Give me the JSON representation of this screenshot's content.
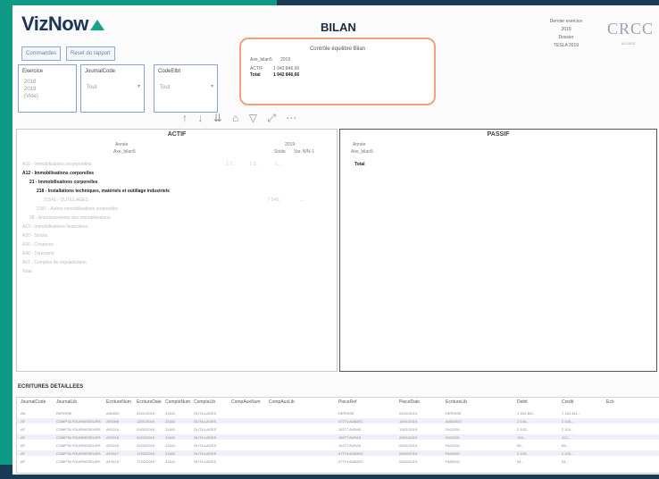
{
  "app": {
    "logo_text": "VizNow",
    "page_title": "BILAN"
  },
  "buttons": {
    "b1": "Commandes",
    "b2": "Reset du rapport"
  },
  "slicers": [
    {
      "title": "Exercice",
      "options": [
        "2018",
        "2019",
        "(Vide)"
      ]
    },
    {
      "title": "JournalCode",
      "value": "Tout"
    },
    {
      "title": "CodeEtbt",
      "value": "Tout"
    }
  ],
  "control": {
    "title": "Contrôle équilibre Bilan",
    "col1": "Axe_bilan5",
    "col2": "2019",
    "r1_label": "ACTIF",
    "r1_val": "1 942 846,66",
    "r2_label": "Total",
    "r2_val": "1 942 846,66"
  },
  "meta": {
    "l1": "Dernier exercice",
    "l2": "2019",
    "l3": "Dossier",
    "l4": "TESLA 2019"
  },
  "brand": {
    "name": "CRCC",
    "sub": "ALSACE"
  },
  "toolbar": {
    "up": "↑",
    "down": "↓",
    "split": "⇊",
    "home": "⌂",
    "filter": "▽",
    "expand": "⤢",
    "more": "⋯"
  },
  "actif": {
    "title": "ACTIF",
    "year_label": "Année",
    "axe_label": "Axe_bilan5",
    "year": "2019",
    "c1": "Solde",
    "c2": "Var. N/N-1",
    "rows": [
      {
        "label": "A10 - Immobilisations incorporelles",
        "bold": false,
        "indent": 0,
        "v": [
          "1 2..",
          "1 3..",
          "1..."
        ]
      },
      {
        "label": "A12 - Immobilisations corporelles",
        "bold": true,
        "indent": 0,
        "v": [
          "",
          "",
          "",
          ""
        ]
      },
      {
        "label": "21 - Immobilisations corporelles",
        "bold": true,
        "indent": 1,
        "v": [
          "",
          "",
          "",
          ""
        ]
      },
      {
        "label": "218 - Installations techniques, matériels et outillage industriels",
        "bold": true,
        "indent": 2,
        "v": [
          "",
          "",
          "",
          ""
        ]
      },
      {
        "label": "21541 - OUTILLAGES",
        "bold": false,
        "indent": 3,
        "v": [
          "",
          "",
          "7 548,-",
          "...."
        ]
      },
      {
        "label": "2181 - Autres immobilisations corporelles",
        "bold": false,
        "indent": 2,
        "v": [
          "",
          "",
          "",
          ""
        ]
      },
      {
        "label": "28 - Amortissements des immobilisations",
        "bold": false,
        "indent": 1,
        "v": [
          "",
          "",
          "",
          ""
        ]
      },
      {
        "label": "A13 - Immobilisations financières",
        "bold": false,
        "indent": 0,
        "v": [
          "",
          "",
          "",
          ""
        ]
      },
      {
        "label": "A20 - Stocks",
        "bold": false,
        "indent": 0,
        "v": [
          "",
          "",
          "",
          ""
        ]
      },
      {
        "label": "A30 - Créances",
        "bold": false,
        "indent": 0,
        "v": [
          "",
          "",
          "",
          ""
        ]
      },
      {
        "label": "A40 - Trésorerie",
        "bold": false,
        "indent": 0,
        "v": [
          "",
          "",
          "",
          ""
        ]
      },
      {
        "label": "A51 - Comptes de régularisation",
        "bold": false,
        "indent": 0,
        "v": [
          "",
          "",
          "",
          ""
        ]
      },
      {
        "label": "Total",
        "bold": false,
        "indent": 0,
        "v": [
          "",
          "",
          "",
          ""
        ]
      }
    ]
  },
  "passif": {
    "title": "PASSIF",
    "year_label": "Année",
    "axe_label": "Axe_bilan5",
    "total_label": "Total"
  },
  "ecritures": {
    "title": "ECRITURES DETAILLEES",
    "columns": [
      "JournalCode",
      "JournalLib",
      "EcritureNum",
      "EcritureDate",
      "CompteNum",
      "CompteLib",
      "CompAuxNum",
      "CompAuxLib",
      "PieceRef",
      "PieceDate",
      "EcritureLib",
      "Debit",
      "Credit",
      "Ech"
    ],
    "rows": [
      [
        "AN",
        "REPRISE",
        "AN0000",
        "01/01/2019",
        "21541",
        "OUTILLAGES",
        "",
        "",
        "REPRISE",
        "01/01/2019",
        "REPRISE",
        "1 154 361,-",
        "1 154 361,-"
      ],
      [
        "AF",
        "COMPTA FOURNISSEURS",
        "AF0006",
        "12/01/2019",
        "21541",
        "OUTILLAGES",
        "",
        "",
        "07774 AVADEC",
        "10/01/2019",
        "AVA00017",
        "2 148,-",
        "2 148,-"
      ],
      [
        "AF",
        "COMPTA FOURNISSEURS",
        "AF0214",
        "01/02/2019",
        "21541",
        "OUTILLAGES",
        "",
        "",
        "15277 AVRAS",
        "13/01/2019",
        "FA12001",
        "2 103,-",
        "2 103,-"
      ],
      [
        "AF",
        "COMPTA FOURNISSEURS",
        "AF0216",
        "01/02/2019",
        "21541",
        "OUTILLAGES",
        "",
        "",
        "15277 AVRAS",
        "20/01/2019",
        "FA12001",
        "122,-",
        "122,-"
      ],
      [
        "AF",
        "COMPTA FOURNISSEURS",
        "AF0216",
        "01/02/2019",
        "21541",
        "OUTILLAGES",
        "",
        "",
        "15277 AVRAS",
        "20/01/2019",
        "FA12001",
        "65,-",
        "65,-"
      ],
      [
        "AF",
        "COMPTA FOURNISSEURS",
        "AF0417",
        "17/02/2019",
        "21541",
        "OUTILLAGES",
        "",
        "",
        "07774 AVADEC",
        "09/02/2019",
        "FA00001",
        "2 105,-",
        "2 105,-"
      ],
      [
        "AF",
        "COMPTA FOURNISSEURS",
        "AF0419",
        "17/02/2019",
        "21541",
        "OUTILLAGES",
        "",
        "",
        "07774 AVADEC",
        "09/02/2019",
        "FA00001",
        "54,-",
        "54,-"
      ]
    ]
  },
  "colors": {
    "frame_green": "#0f9a86",
    "frame_navy": "#1b3a57",
    "accent_orange": "#f0a27a"
  }
}
